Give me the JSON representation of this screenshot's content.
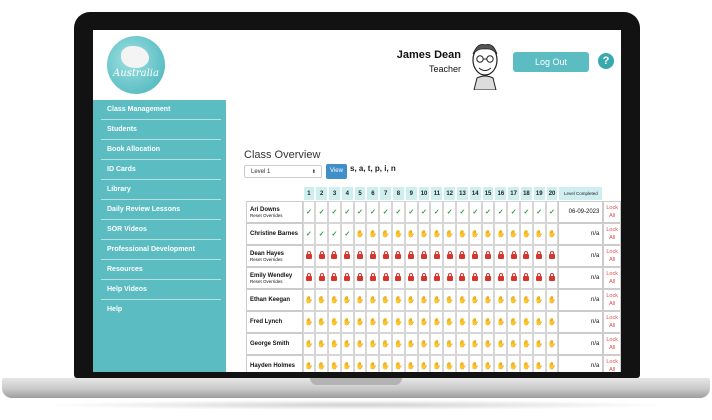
{
  "header": {
    "logo_text": "Australia",
    "user_name": "James Dean",
    "user_role": "Teacher",
    "logout_label": "Log Out",
    "help_label": "?"
  },
  "sidebar": {
    "items": [
      "Class Management",
      "Students",
      "Book Allocation",
      "ID Cards",
      "Library",
      "Daily Review Lessons",
      "SOR Videos",
      "Professional Development",
      "Resources",
      "Help Videos",
      "Help"
    ]
  },
  "main": {
    "title": "Class Overview",
    "level_select": "Level 1",
    "view_label": "View",
    "sounds": "s, a, t, p, i, n",
    "columns": [
      "1",
      "2",
      "3",
      "4",
      "5",
      "6",
      "7",
      "8",
      "9",
      "10",
      "11",
      "12",
      "13",
      "14",
      "15",
      "16",
      "17",
      "18",
      "19",
      "20"
    ],
    "level_completed_header": "Level Completed",
    "lock_label_1": "Lock",
    "lock_label_2": "All",
    "students": [
      {
        "name": "Ari Downs",
        "reset": "Reset Overrides",
        "cells": "TTTTTTTTTTTTTTTTTTTT",
        "level": "06-09-2023"
      },
      {
        "name": "Christine Barnes",
        "reset": "",
        "cells": "TTTTHHHHHHHHHHHHHHHH",
        "level": "n/a"
      },
      {
        "name": "Dean Hayes",
        "reset": "Reset Overrides",
        "cells": "LLLLLLLLLLLLLLLLLLLL",
        "level": "n/a"
      },
      {
        "name": "Emily Wendley",
        "reset": "Reset Overrides",
        "cells": "LLLLLLLLLLLLLLLLLLLL",
        "level": "n/a"
      },
      {
        "name": "Ethan Keegan",
        "reset": "",
        "cells": "HHHHHHHHHHHHHHHHHHHH",
        "level": "n/a"
      },
      {
        "name": "Fred Lynch",
        "reset": "",
        "cells": "HHHHHHHHHHHHHHHHHHHH",
        "level": "n/a"
      },
      {
        "name": "George Smith",
        "reset": "",
        "cells": "HHHHHHHHHHHHHHHHHHHH",
        "level": "n/a"
      },
      {
        "name": "Hayden Holmes",
        "reset": "",
        "cells": "HHHHHHHHHHHHHHHHHHHH",
        "level": "n/a"
      }
    ]
  },
  "icons": {
    "completed": "check-icon",
    "in_progress": "hand-icon",
    "locked": "padlock-icon"
  }
}
